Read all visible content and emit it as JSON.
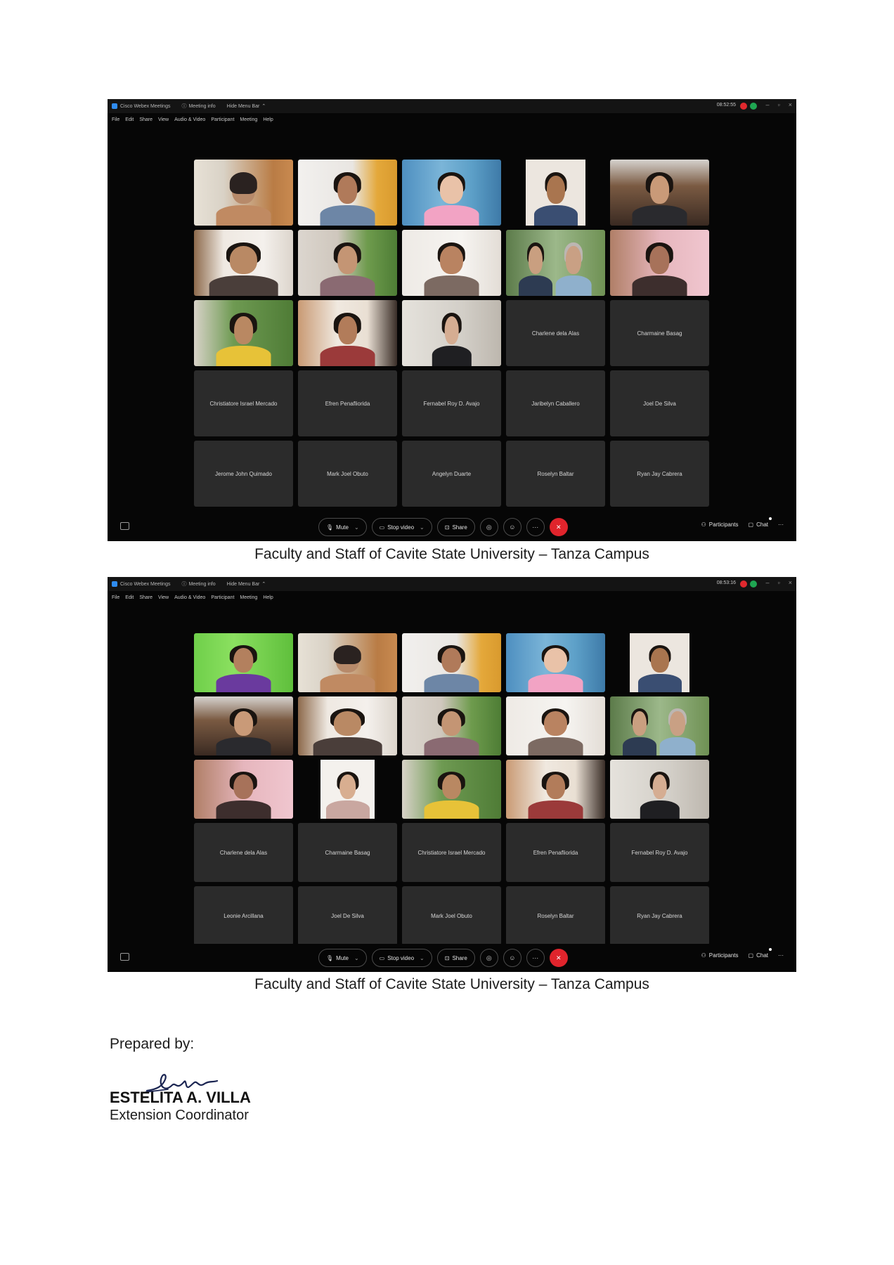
{
  "window": {
    "app_name": "Cisco Webex Meetings",
    "meeting_info": "Meeting info",
    "hide_menu_bar": "Hide Menu Bar",
    "clock_1": "08:52:55",
    "clock_2": "08:53:16"
  },
  "menubar": {
    "items": [
      "File",
      "Edit",
      "Share",
      "View",
      "Audio & Video",
      "Participant",
      "Meeting",
      "Help"
    ]
  },
  "toolbar": {
    "mute_label": "Mute",
    "stop_video_label": "Stop video",
    "share_label": "Share",
    "participants_label": "Participants",
    "chat_label": "Chat",
    "end_icon": "x-icon"
  },
  "screenshot_1": {
    "name_tiles": [
      "Charlene dela Alas",
      "Charmaine Basag",
      "Christiatore Israel Mercado",
      "Efren Penafliorida",
      "Fernabel Roy D. Avajo",
      "Jaribelyn Caballero",
      "Joel De Silva",
      "Jerome John Quimado",
      "Mark Joel Obuto",
      "Angelyn Duarte",
      "Roselyn Baltar",
      "Ryan Jay Cabrera"
    ]
  },
  "screenshot_2": {
    "name_tiles": [
      "Charlene dela Alas",
      "Charmaine Basag",
      "Christiatore Israel Mercado",
      "Efren Penafliorida",
      "Fernabel Roy D. Avajo",
      "Leonie Arcillana",
      "Joel De Silva",
      "Mark Joel Obuto",
      "Roselyn Baltar",
      "Ryan Jay Cabrera"
    ]
  },
  "captions": {
    "caption_1": "Faculty and Staff of Cavite State University – Tanza Campus",
    "caption_2": "Faculty and Staff of Cavite State University – Tanza Campus"
  },
  "footer": {
    "prepared_by": "Prepared by:",
    "signature_text": "Villa",
    "name": "ESTELITA A. VILLA",
    "title": "Extension Coordinator"
  },
  "colors": {
    "end_button": "#e0242c",
    "tile_background": "#2b2b2b",
    "window_background": "#060606"
  }
}
